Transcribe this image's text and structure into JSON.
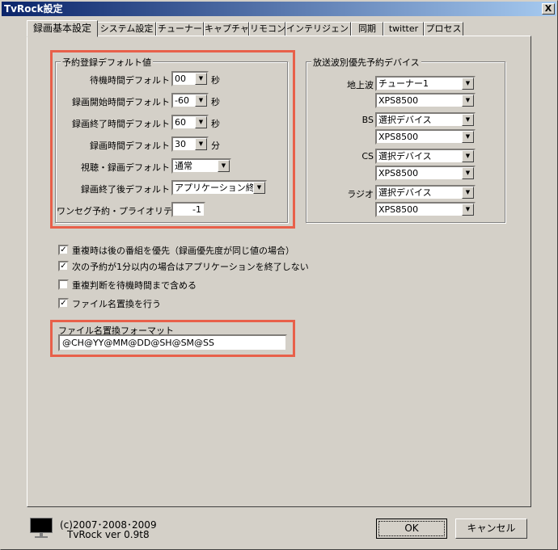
{
  "window": {
    "title": "TvRock設定",
    "close": "X"
  },
  "tabs": [
    "録画基本設定",
    "システム設定",
    "チューナー",
    "キャプチャ",
    "リモコン",
    "インテリジェント",
    "同期",
    "twitter",
    "プロセス"
  ],
  "defaults": {
    "title": "予約登録デフォルト値",
    "rows": [
      {
        "label": "待機時間デフォルト",
        "value": "00",
        "unit": "秒"
      },
      {
        "label": "録画開始時間デフォルト",
        "value": "-60",
        "unit": "秒"
      },
      {
        "label": "録画終了時間デフォルト",
        "value": "60",
        "unit": "秒"
      },
      {
        "label": "録画時間デフォルト",
        "value": "30",
        "unit": "分"
      },
      {
        "label": "視聴・録画デフォルト",
        "value": "通常"
      },
      {
        "label": "録画終了後デフォルト",
        "value": "アプリケーション終了"
      },
      {
        "label": "ワンセグ予約・プライオリティ",
        "value": "-1"
      }
    ]
  },
  "devices": {
    "title": "放送波別優先予約デバイス",
    "rows": [
      {
        "label": "地上波",
        "device": "チューナー1",
        "pc": "XPS8500"
      },
      {
        "label": "BS",
        "device": "選択デバイス",
        "pc": "XPS8500"
      },
      {
        "label": "CS",
        "device": "選択デバイス",
        "pc": "XPS8500"
      },
      {
        "label": "ラジオ",
        "device": "選択デバイス",
        "pc": "XPS8500"
      }
    ]
  },
  "options": [
    {
      "label": "重複時は後の番組を優先（録画優先度が同じ値の場合）",
      "checked": true
    },
    {
      "label": "次の予約が1分以内の場合はアプリケーションを終了しない",
      "checked": true
    },
    {
      "label": "重複判断を待機時間まで含める",
      "checked": false
    },
    {
      "label": "ファイル名置換を行う",
      "checked": true
    }
  ],
  "filename": {
    "label": "ファイル名置換フォーマット",
    "value": "@CH@YY@MM@DD@SH@SM@SS"
  },
  "footer": {
    "copyright": "(c)2007･2008･2009",
    "version": "TvRock ver 0.9t8",
    "ok": "OK",
    "cancel": "キャンセル"
  },
  "colors": {
    "highlight": "#e8604a",
    "titlebar_start": "#0a246a",
    "titlebar_end": "#a6caf0"
  }
}
